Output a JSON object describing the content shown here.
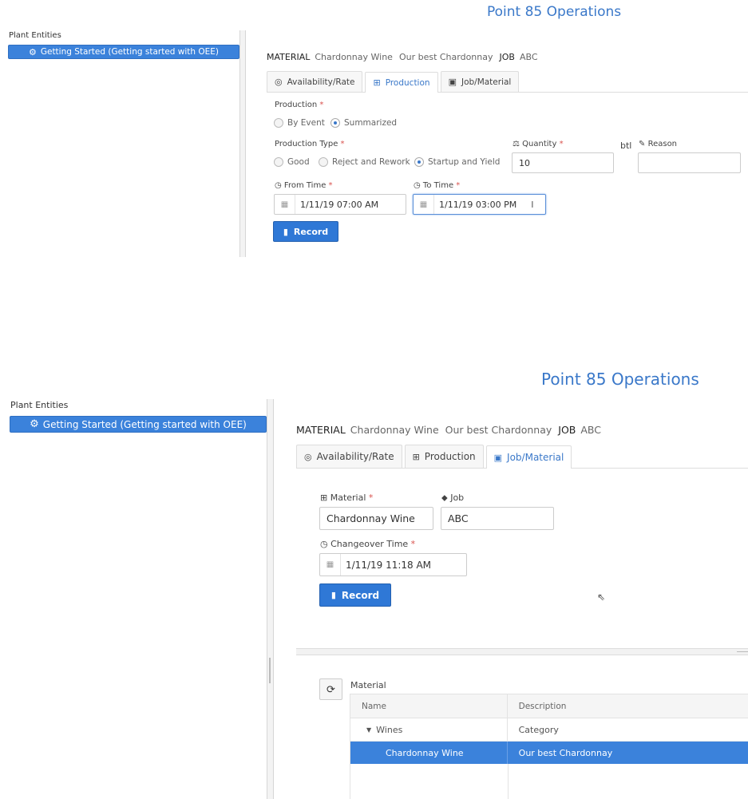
{
  "screens": [
    {
      "app_title": "Point 85 Operations",
      "sidebar": {
        "label": "Plant Entities",
        "entity_button": "Getting Started (Getting started with OEE)"
      },
      "context": {
        "material_key": "MATERIAL",
        "material_name": "Chardonnay Wine",
        "material_desc": "Our best Chardonnay",
        "job_key": "JOB",
        "job_value": "ABC"
      },
      "tabs": [
        {
          "label": "Availability/Rate",
          "icon": "gauge-icon",
          "active": false
        },
        {
          "label": "Production",
          "icon": "sitemap-icon",
          "active": true
        },
        {
          "label": "Job/Material",
          "icon": "cube-icon",
          "active": false
        }
      ],
      "production": {
        "production_label": "Production",
        "production_options": [
          {
            "label": "By Event",
            "selected": false
          },
          {
            "label": "Summarized",
            "selected": true
          }
        ],
        "type_label": "Production Type",
        "type_options": [
          {
            "label": "Good",
            "selected": false
          },
          {
            "label": "Reject and Rework",
            "selected": false
          },
          {
            "label": "Startup and Yield",
            "selected": true
          }
        ],
        "quantity_label": "Quantity",
        "quantity_value": "10",
        "unit": "btl",
        "reason_label": "Reason",
        "reason_value": "",
        "from_label": "From Time",
        "from_value": "1/11/19 07:00 AM",
        "to_label": "To Time",
        "to_value": "1/11/19 03:00 PM",
        "record_label": "Record"
      }
    },
    {
      "app_title": "Point 85 Operations",
      "sidebar": {
        "label": "Plant Entities",
        "entity_button": "Getting Started (Getting started with OEE)"
      },
      "context": {
        "material_key": "MATERIAL",
        "material_name": "Chardonnay Wine",
        "material_desc": "Our best Chardonnay",
        "job_key": "JOB",
        "job_value": "ABC"
      },
      "tabs": [
        {
          "label": "Availability/Rate",
          "icon": "gauge-icon",
          "active": false
        },
        {
          "label": "Production",
          "icon": "sitemap-icon",
          "active": false
        },
        {
          "label": "Job/Material",
          "icon": "cube-icon",
          "active": true
        }
      ],
      "job_material": {
        "material_label": "Material",
        "material_value": "Chardonnay Wine",
        "job_label": "Job",
        "job_value": "ABC",
        "changeover_label": "Changeover Time",
        "changeover_value": "1/11/19 11:18 AM",
        "record_label": "Record"
      },
      "material_grid": {
        "title": "Material",
        "columns": [
          "Name",
          "Description"
        ],
        "rows": [
          {
            "name": "Wines",
            "description": "Category",
            "expanded": true,
            "selected": false
          },
          {
            "name": "Chardonnay Wine",
            "description": "Our best Chardonnay",
            "selected": true
          }
        ]
      }
    }
  ],
  "colors": {
    "accent": "#3a78c9",
    "button": "#2f78d6",
    "selected_row": "#3b82db",
    "required": "#d9534f"
  }
}
